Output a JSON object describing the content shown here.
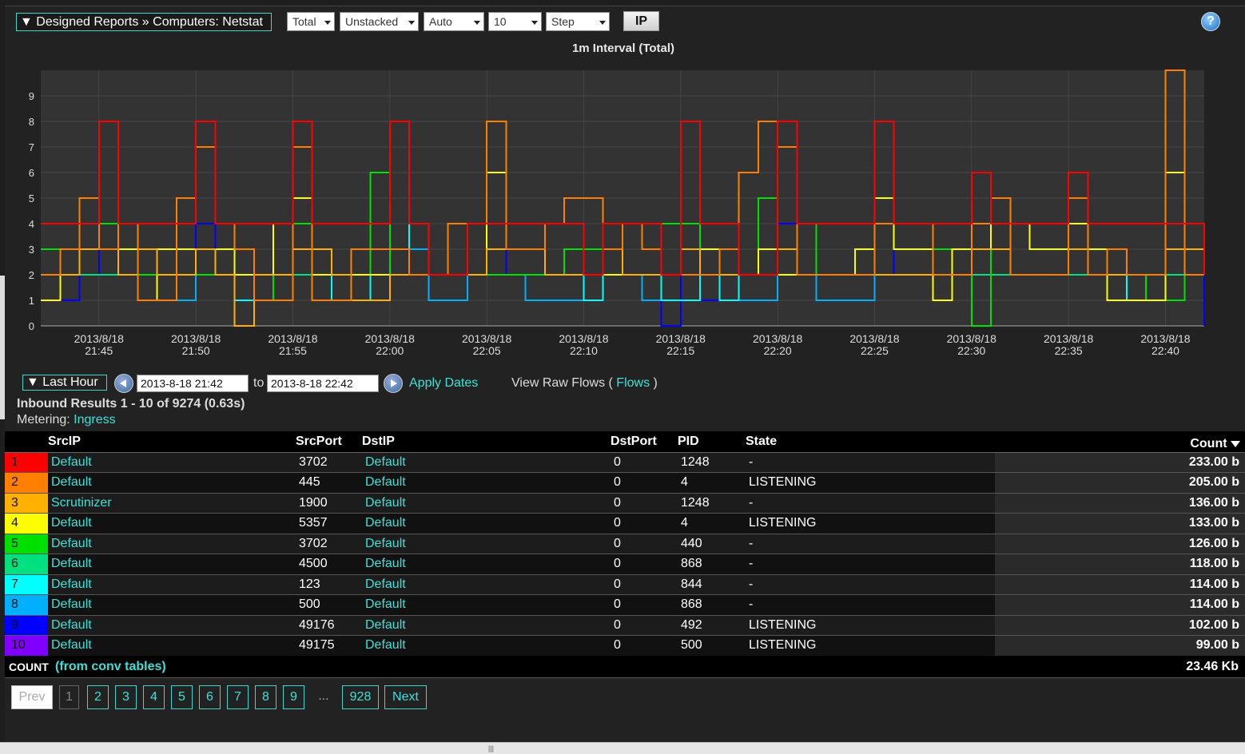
{
  "toolbar": {
    "breadcrumb": "▼ Designed Reports » Computers: Netstat",
    "selects": [
      "Total",
      "Unstacked",
      "Auto",
      "10",
      "Step"
    ],
    "ip_button": "IP",
    "help_label": "?"
  },
  "chart_data": {
    "type": "line",
    "title": "1m Interval (Total)",
    "xlabel": "",
    "ylabel": "",
    "ylim": [
      0,
      10
    ],
    "yticks": [
      0,
      1,
      2,
      3,
      4,
      5,
      6,
      7,
      8,
      9
    ],
    "grid": true,
    "step": true,
    "x": [
      "2013/8/18 21:42",
      "21:43",
      "21:44",
      "21:45",
      "21:46",
      "21:47",
      "21:48",
      "21:49",
      "21:50",
      "21:51",
      "21:52",
      "21:53",
      "21:54",
      "21:55",
      "21:56",
      "21:57",
      "21:58",
      "21:59",
      "22:00",
      "22:01",
      "22:02",
      "22:03",
      "22:04",
      "22:05",
      "22:06",
      "22:07",
      "22:08",
      "22:09",
      "22:10",
      "22:11",
      "22:12",
      "22:13",
      "22:14",
      "22:15",
      "22:16",
      "22:17",
      "22:18",
      "22:19",
      "22:20",
      "22:21",
      "22:22",
      "22:23",
      "22:24",
      "22:25",
      "22:26",
      "22:27",
      "22:28",
      "22:29",
      "22:30",
      "22:31",
      "22:32",
      "22:33",
      "22:34",
      "22:35",
      "22:36",
      "22:37",
      "22:38",
      "22:39",
      "22:40",
      "22:41",
      "22:42"
    ],
    "xtick_labels": [
      {
        "date": "2013/8/18",
        "time": "21:45"
      },
      {
        "date": "2013/8/18",
        "time": "21:50"
      },
      {
        "date": "2013/8/18",
        "time": "21:55"
      },
      {
        "date": "2013/8/18",
        "time": "22:00"
      },
      {
        "date": "2013/8/18",
        "time": "22:05"
      },
      {
        "date": "2013/8/18",
        "time": "22:10"
      },
      {
        "date": "2013/8/18",
        "time": "22:15"
      },
      {
        "date": "2013/8/18",
        "time": "22:20"
      },
      {
        "date": "2013/8/18",
        "time": "22:25"
      },
      {
        "date": "2013/8/18",
        "time": "22:30"
      },
      {
        "date": "2013/8/18",
        "time": "22:35"
      },
      {
        "date": "2013/8/18",
        "time": "22:40"
      }
    ],
    "series": [
      {
        "color": "#ff0000",
        "values": [
          4,
          4,
          4,
          8,
          4,
          4,
          4,
          4,
          8,
          4,
          4,
          4,
          4,
          8,
          4,
          4,
          4,
          4,
          8,
          4,
          2,
          2,
          4,
          4,
          4,
          4,
          4,
          4,
          2,
          4,
          4,
          4,
          2,
          8,
          4,
          4,
          2,
          2,
          8,
          4,
          4,
          4,
          4,
          8,
          4,
          4,
          4,
          4,
          6,
          4,
          4,
          4,
          4,
          6,
          4,
          4,
          4,
          4,
          4,
          4,
          2
        ]
      },
      {
        "color": "#ff8000",
        "values": [
          2,
          3,
          5,
          3,
          4,
          1,
          1,
          5,
          7,
          4,
          3,
          1,
          1,
          7,
          1,
          1,
          3,
          3,
          3,
          2,
          2,
          4,
          4,
          8,
          3,
          3,
          4,
          5,
          5,
          3,
          4,
          3,
          2,
          2,
          2,
          3,
          6,
          8,
          7,
          2,
          2,
          2,
          2,
          4,
          4,
          4,
          2,
          2,
          4,
          5,
          2,
          2,
          2,
          5,
          2,
          3,
          2,
          2,
          10,
          2,
          2
        ]
      },
      {
        "color": "#ffb000",
        "values": [
          2,
          2,
          3,
          3,
          2,
          3,
          2,
          2,
          3,
          2,
          0,
          2,
          2,
          3,
          3,
          2,
          1,
          1,
          2,
          2,
          2,
          2,
          2,
          3,
          3,
          3,
          2,
          2,
          2,
          3,
          2,
          2,
          2,
          3,
          2,
          2,
          2,
          2,
          3,
          2,
          2,
          2,
          2,
          2,
          2,
          2,
          2,
          2,
          3,
          3,
          2,
          2,
          2,
          3,
          2,
          2,
          2,
          2,
          3,
          3,
          2
        ]
      },
      {
        "color": "#ffff00",
        "values": [
          1,
          3,
          3,
          3,
          3,
          1,
          3,
          3,
          3,
          3,
          2,
          2,
          4,
          5,
          2,
          2,
          2,
          2,
          2,
          2,
          2,
          2,
          2,
          6,
          3,
          3,
          2,
          2,
          2,
          2,
          2,
          2,
          2,
          3,
          3,
          2,
          2,
          3,
          2,
          2,
          2,
          2,
          3,
          5,
          3,
          3,
          1,
          3,
          4,
          3,
          4,
          3,
          3,
          4,
          3,
          1,
          1,
          1,
          6,
          3,
          2
        ]
      },
      {
        "color": "#00e000",
        "values": [
          3,
          2,
          4,
          4,
          2,
          2,
          2,
          2,
          2,
          3,
          3,
          1,
          4,
          4,
          3,
          2,
          2,
          6,
          2,
          2,
          2,
          2,
          2,
          2,
          2,
          2,
          2,
          3,
          3,
          2,
          2,
          2,
          4,
          4,
          2,
          2,
          2,
          5,
          3,
          4,
          2,
          2,
          2,
          2,
          2,
          2,
          3,
          3,
          0,
          3,
          2,
          2,
          2,
          4,
          2,
          2,
          2,
          1,
          1,
          2,
          2
        ]
      },
      {
        "color": "#00e080",
        "values": [
          2,
          2,
          2,
          2,
          2,
          2,
          2,
          2,
          2,
          2,
          2,
          2,
          2,
          2,
          2,
          2,
          2,
          2,
          2,
          2,
          2,
          2,
          2,
          2,
          2,
          2,
          2,
          2,
          2,
          2,
          2,
          2,
          2,
          2,
          2,
          2,
          2,
          2,
          2,
          2,
          2,
          2,
          2,
          2,
          2,
          2,
          2,
          2,
          2,
          2,
          2,
          2,
          2,
          2,
          2,
          2,
          2,
          2,
          2,
          2,
          2
        ]
      },
      {
        "color": "#00ffff",
        "values": [
          2,
          2,
          2,
          2,
          2,
          1,
          1,
          2,
          2,
          2,
          1,
          2,
          2,
          2,
          2,
          1,
          1,
          2,
          2,
          4,
          2,
          2,
          2,
          2,
          2,
          2,
          2,
          2,
          1,
          2,
          2,
          2,
          1,
          1,
          2,
          1,
          2,
          2,
          2,
          2,
          2,
          2,
          2,
          2,
          2,
          2,
          2,
          2,
          2,
          2,
          2,
          2,
          2,
          3,
          2,
          2,
          1,
          1,
          2,
          2,
          2
        ]
      },
      {
        "color": "#00b0ff",
        "values": [
          2,
          2,
          2,
          2,
          2,
          1,
          1,
          1,
          2,
          2,
          1,
          1,
          2,
          2,
          2,
          1,
          1,
          1,
          2,
          3,
          1,
          1,
          2,
          2,
          2,
          1,
          1,
          1,
          2,
          2,
          2,
          1,
          1,
          1,
          2,
          1,
          1,
          1,
          2,
          2,
          1,
          1,
          1,
          2,
          2,
          2,
          2,
          2,
          2,
          2,
          2,
          2,
          2,
          3,
          2,
          2,
          1,
          1,
          2,
          2,
          2
        ]
      },
      {
        "color": "#0000ff",
        "values": [
          2,
          1,
          2,
          4,
          2,
          1,
          1,
          1,
          4,
          2,
          1,
          1,
          1,
          4,
          2,
          1,
          1,
          1,
          2,
          3,
          1,
          1,
          2,
          4,
          2,
          1,
          1,
          1,
          2,
          2,
          2,
          2,
          0,
          4,
          1,
          1,
          1,
          1,
          4,
          2,
          1,
          1,
          1,
          4,
          2,
          2,
          2,
          2,
          3,
          2,
          2,
          2,
          2,
          2,
          2,
          2,
          1,
          1,
          3,
          2,
          0
        ]
      },
      {
        "color": "#8000ff",
        "values": [
          2,
          1,
          2,
          4,
          2,
          1,
          1,
          1,
          4,
          2,
          1,
          1,
          1,
          4,
          2,
          1,
          1,
          1,
          2,
          3,
          1,
          1,
          2,
          4,
          2,
          1,
          1,
          1,
          2,
          2,
          2,
          2,
          1,
          4,
          1,
          1,
          1,
          1,
          4,
          2,
          1,
          1,
          1,
          4,
          2,
          2,
          2,
          2,
          3,
          2,
          2,
          2,
          2,
          2,
          2,
          2,
          1,
          1,
          3,
          2,
          2
        ]
      }
    ]
  },
  "dates": {
    "range_label": "▼ Last Hour",
    "from": "2013-8-18 21:42",
    "to_label": "to",
    "to": "2013-8-18 22:42",
    "apply": "Apply Dates",
    "raw_prefix": "View Raw Flows (",
    "raw_link": "Flows",
    "raw_suffix": ")"
  },
  "results": {
    "summary": "Inbound Results 1 - 10 of 9274 (0.63s)",
    "metering_label": "Metering:",
    "metering_value": "Ingress"
  },
  "table": {
    "headers": {
      "srcip": "SrcIP",
      "srcport": "SrcPort",
      "dstip": "DstIP",
      "dstport": "DstPort",
      "pid": "PID",
      "state": "State",
      "count": "Count"
    },
    "rows": [
      {
        "n": "1",
        "color": "#ff0000",
        "srcip": "Default",
        "srcport": "3702",
        "dstip": "Default",
        "dstport": "0",
        "pid": "1248",
        "state": "-",
        "count": "233.00 b"
      },
      {
        "n": "2",
        "color": "#ff8000",
        "srcip": "Default",
        "srcport": "445",
        "dstip": "Default",
        "dstport": "0",
        "pid": "4",
        "state": "LISTENING",
        "count": "205.00 b"
      },
      {
        "n": "3",
        "color": "#ffb000",
        "srcip": "Scrutinizer",
        "srcport": "1900",
        "dstip": "Default",
        "dstport": "0",
        "pid": "1248",
        "state": "-",
        "count": "136.00 b"
      },
      {
        "n": "4",
        "color": "#ffff00",
        "srcip": "Default",
        "srcport": "5357",
        "dstip": "Default",
        "dstport": "0",
        "pid": "4",
        "state": "LISTENING",
        "count": "133.00 b"
      },
      {
        "n": "5",
        "color": "#00e000",
        "srcip": "Default",
        "srcport": "3702",
        "dstip": "Default",
        "dstport": "0",
        "pid": "440",
        "state": "-",
        "count": "126.00 b"
      },
      {
        "n": "6",
        "color": "#00e080",
        "srcip": "Default",
        "srcport": "4500",
        "dstip": "Default",
        "dstport": "0",
        "pid": "868",
        "state": "-",
        "count": "118.00 b"
      },
      {
        "n": "7",
        "color": "#00ffff",
        "srcip": "Default",
        "srcport": "123",
        "dstip": "Default",
        "dstport": "0",
        "pid": "844",
        "state": "-",
        "count": "114.00 b"
      },
      {
        "n": "8",
        "color": "#00b0ff",
        "srcip": "Default",
        "srcport": "500",
        "dstip": "Default",
        "dstport": "0",
        "pid": "868",
        "state": "-",
        "count": "114.00 b"
      },
      {
        "n": "9",
        "color": "#0000ff",
        "srcip": "Default",
        "srcport": "49176",
        "dstip": "Default",
        "dstport": "0",
        "pid": "492",
        "state": "LISTENING",
        "count": "102.00 b"
      },
      {
        "n": "10",
        "color": "#8000ff",
        "srcip": "Default",
        "srcport": "49175",
        "dstip": "Default",
        "dstport": "0",
        "pid": "500",
        "state": "LISTENING",
        "count": "99.00 b"
      }
    ],
    "count_label": "COUNT",
    "count_source": "(from conv tables)",
    "count_total": "23.46 Kb"
  },
  "pager": {
    "prev": "Prev",
    "pages": [
      "1",
      "2",
      "3",
      "4",
      "5",
      "6",
      "7",
      "8",
      "9"
    ],
    "dots": "...",
    "last": "928",
    "next": "Next"
  },
  "grip": "|||"
}
